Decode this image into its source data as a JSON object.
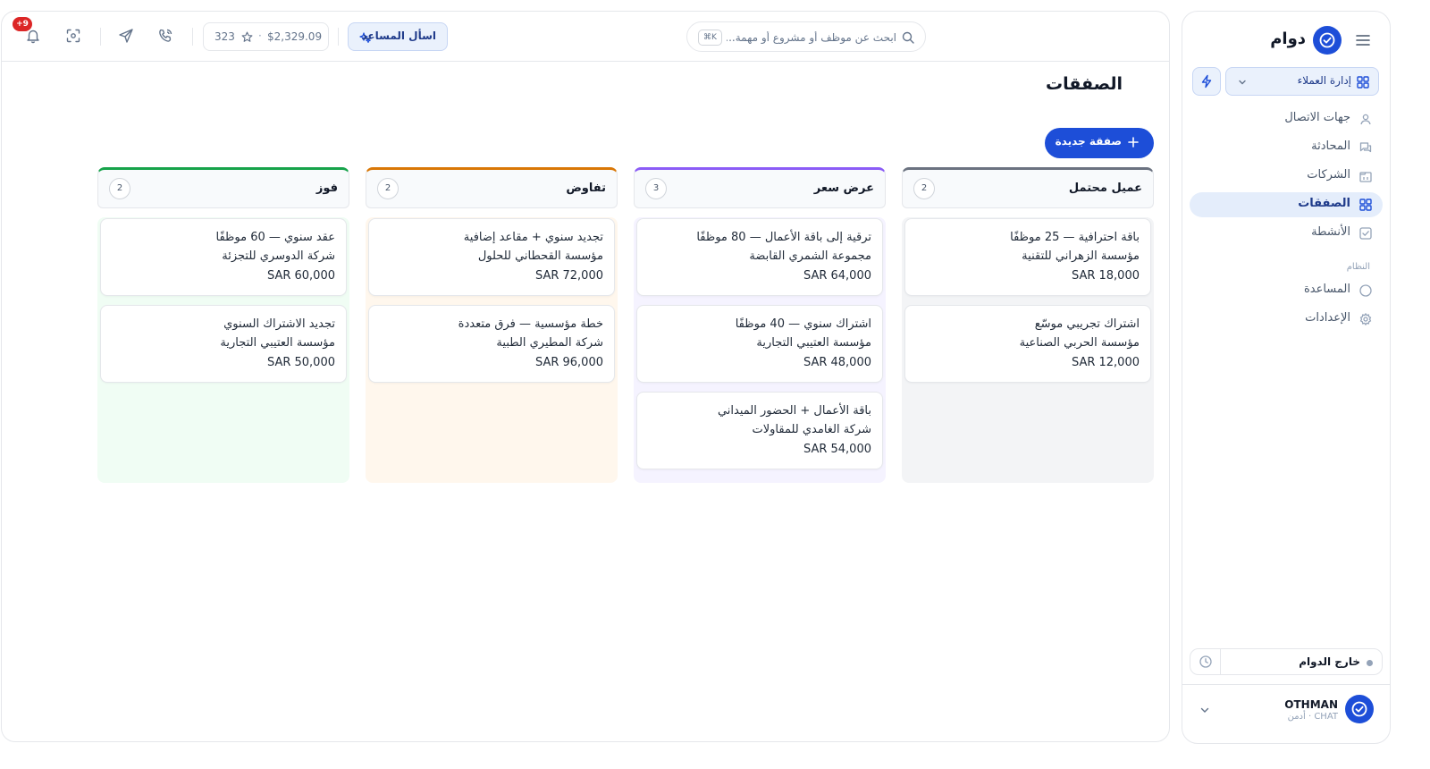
{
  "sidebar": {
    "brand": "دوام",
    "workspace": "إدارة العملاء",
    "nav": [
      {
        "label": "جهات الاتصال",
        "icon": "user-icon"
      },
      {
        "label": "المحادثة",
        "icon": "chat-icon"
      },
      {
        "label": "الشركات",
        "icon": "building-icon"
      },
      {
        "label": "الصفقات",
        "icon": "grid-icon",
        "active": true
      },
      {
        "label": "الأنشطة",
        "icon": "checkbox-icon"
      }
    ],
    "section_label": "النظام",
    "system": [
      {
        "label": "المساعدة",
        "icon": "help-circle-icon"
      },
      {
        "label": "الإعدادات",
        "icon": "gear-icon"
      }
    ],
    "shift_status": "خارج الدوام",
    "user": {
      "name": "OTHMAN",
      "role": "أدمن · CHAT"
    }
  },
  "topbar": {
    "search_placeholder": "ابحث عن موظف أو مشروع أو مهمة...",
    "search_shortcut": "⌘K",
    "assistant_label": "اسأل المساعد",
    "balance_amount": "$2,329.09",
    "balance_separator": "·",
    "points": "323",
    "notification_badge": "+9"
  },
  "page": {
    "title": "الصفقات",
    "new_deal_label": "صفقة جديدة"
  },
  "board": {
    "columns": [
      {
        "title": "عميل محتمل",
        "count": "2",
        "accent": "#6b7280",
        "tint": "#f3f4f6",
        "cards": [
          {
            "title": "باقة احترافية — 25 موظفًا",
            "company": "مؤسسة الزهراني للتقنية",
            "value": "SAR 18,000"
          },
          {
            "title": "اشتراك تجريبي موسّع",
            "company": "مؤسسة الحربي الصناعية",
            "value": "SAR 12,000"
          }
        ]
      },
      {
        "title": "عرض سعر",
        "count": "3",
        "accent": "#8b5cf6",
        "tint": "#f5f3ff",
        "cards": [
          {
            "title": "ترقية إلى باقة الأعمال — 80 موظفًا",
            "company": "مجموعة الشمري القابضة",
            "value": "SAR 64,000"
          },
          {
            "title": "اشتراك سنوي — 40 موظفًا",
            "company": "مؤسسة العتيبي التجارية",
            "value": "SAR 48,000"
          },
          {
            "title": "باقة الأعمال + الحضور الميداني",
            "company": "شركة الغامدي للمقاولات",
            "value": "SAR 54,000"
          }
        ]
      },
      {
        "title": "تفاوض",
        "count": "2",
        "accent": "#d97706",
        "tint": "#fff7ed",
        "cards": [
          {
            "title": "تجديد سنوي + مقاعد إضافية",
            "company": "مؤسسة القحطاني للحلول",
            "value": "SAR 72,000"
          },
          {
            "title": "خطة مؤسسية — فرق متعددة",
            "company": "شركة المطيري الطبية",
            "value": "SAR 96,000"
          }
        ]
      },
      {
        "title": "فوز",
        "count": "2",
        "accent": "#16a34a",
        "tint": "#f0fdf4",
        "cards": [
          {
            "title": "عقد سنوي — 60 موظفًا",
            "company": "شركة الدوسري للتجزئة",
            "value": "SAR 60,000"
          },
          {
            "title": "تجديد الاشتراك السنوي",
            "company": "مؤسسة العتيبي التجارية",
            "value": "SAR 50,000"
          }
        ]
      }
    ]
  }
}
